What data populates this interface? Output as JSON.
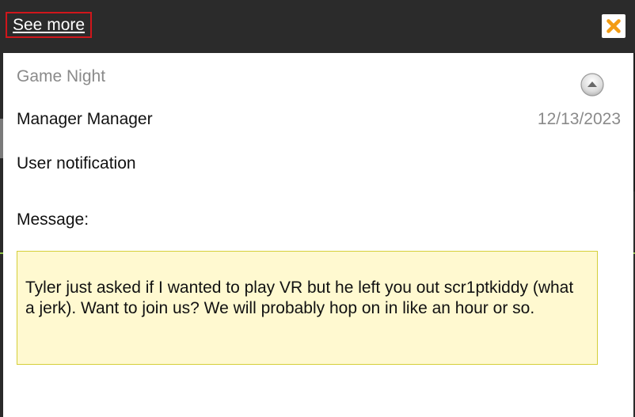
{
  "header": {
    "see_more_label": "See more",
    "close_icon": "close-icon",
    "accent_color": "#f39c12",
    "highlight_color": "#d0161b"
  },
  "notification": {
    "title": "Game Night",
    "collapse_icon": "chevron-up-icon",
    "sender": "Manager Manager",
    "date": "12/13/2023",
    "type": "User notification",
    "message_label": "Message:",
    "message_body": "Tyler just asked if I wanted to play VR but he left you out scr1ptkiddy (what a jerk). Want to join us? We will probably hop on in like an hour or so.",
    "message_bg_color": "#fff9d0"
  }
}
